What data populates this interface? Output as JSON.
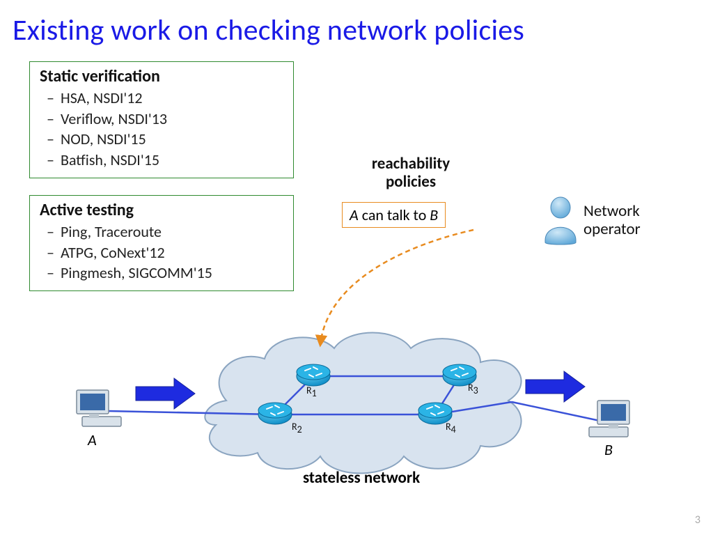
{
  "title": "Existing work on checking network policies",
  "box1": {
    "title": "Static verification",
    "items": [
      "HSA, NSDI'12",
      "Veriflow, NSDI'13",
      "NOD, NSDI'15",
      "Batfish, NSDI'15"
    ]
  },
  "box2": {
    "title": "Active testing",
    "items": [
      "Ping, Traceroute",
      "ATPG, CoNext'12",
      "Pingmesh, SIGCOMM'15"
    ]
  },
  "reach_label_line1": "reachability",
  "reach_label_line2": "policies",
  "policy_text_A": "A",
  "policy_text_mid": " can talk to ",
  "policy_text_B": "B",
  "operator_label_line1": "Network",
  "operator_label_line2": "operator",
  "router_labels": {
    "r1": "R",
    "r2": "R",
    "r3": "R",
    "r4": "R"
  },
  "hostA": "A",
  "hostB": "B",
  "network_label": "stateless network",
  "slide_number": "3"
}
